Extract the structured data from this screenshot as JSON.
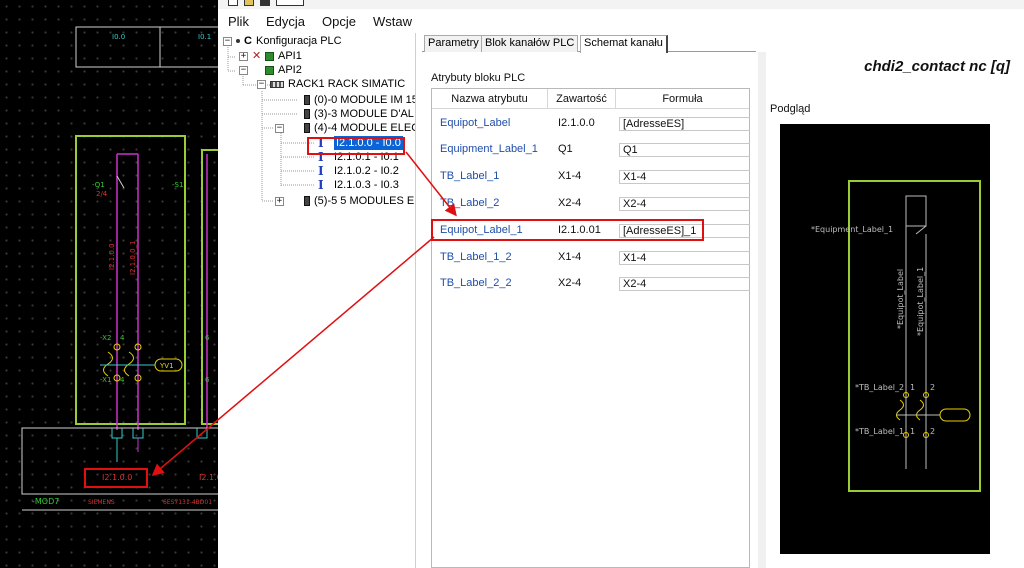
{
  "menu": [
    "Plik",
    "Edycja",
    "Opcje",
    "Wstaw"
  ],
  "tree": {
    "root": "Konfiguracja PLC",
    "api1": "API1",
    "api2": "API2",
    "rack": "RACK1 RACK SIMATIC",
    "modules": [
      "(0)-0 MODULE IM 15",
      "(3)-3 MODULE D'AL",
      "(4)-4 MODULE ELEC"
    ],
    "channels": [
      "I2.1.0.0 - I0.0",
      "I2.1.0.1 - I0.1",
      "I2.1.0.2 - I0.2",
      "I2.1.0.3 - I0.3"
    ],
    "last_module": "(5)-5 5 MODULES E"
  },
  "tabs": [
    "Parametry",
    "Blok kanałów PLC",
    "Schemat kanału"
  ],
  "attributes": {
    "group_label": "Atrybuty bloku PLC",
    "columns": [
      "Nazwa atrybutu",
      "Zawartość",
      "Formuła"
    ],
    "rows": [
      {
        "name": "Equipot_Label",
        "value": "I2.1.0.0",
        "formula": "[AdresseES]"
      },
      {
        "name": "Equipment_Label_1",
        "value": "Q1",
        "formula": "Q1"
      },
      {
        "name": "TB_Label_1",
        "value": "X1-4",
        "formula": "X1-4"
      },
      {
        "name": "TB_Label_2",
        "value": "X2-4",
        "formula": "X2-4"
      },
      {
        "name": "Equipot_Label_1",
        "value": "I2.1.0.01",
        "formula": "[AdresseES]_1"
      },
      {
        "name": "TB_Label_1_2",
        "value": "X1-4",
        "formula": "X1-4"
      },
      {
        "name": "TB_Label_2_2",
        "value": "X2-4",
        "formula": "X2-4"
      }
    ]
  },
  "right": {
    "symbol_title": "chdi2_contact nc [q]",
    "preview_label": "Podgląd",
    "preview_texts": {
      "equipment": "*Equipment_Label_1",
      "equipot": "*Equipot_Label",
      "equipot1": "*Equipot_Label_1",
      "tb2": "*TB_Label_2",
      "tb1": "*TB_Label_1",
      "n1a": "1",
      "n2a": "2",
      "n1b": "1",
      "n2b": "2"
    }
  },
  "cad": {
    "header_left": "I0.0",
    "header_right": "I0.1",
    "q1": "-Q1",
    "q1_num": "2/4",
    "s1": "-S1",
    "wire1": "I2.1.0.0",
    "wire2": "I2.1.0.0_1",
    "x2": "-X2",
    "x2_pin": "4",
    "x1": "-X1",
    "x1_pin": "4",
    "x2b_pin": "6",
    "x1b_pin": "6",
    "ellipse": "YV1",
    "address": "I2.1.0.0",
    "address2": "I2.1.0.1",
    "mod": "-MOD7",
    "vendor": "SIEMENS",
    "part": "6ES7131-4BD01"
  },
  "colors": {
    "green_frame": "#9acd32",
    "magenta": "#cc33cc",
    "cyan": "#33cccc",
    "yellow": "#e8d200",
    "highlight": "#e01010",
    "selection": "#0a64d8"
  }
}
